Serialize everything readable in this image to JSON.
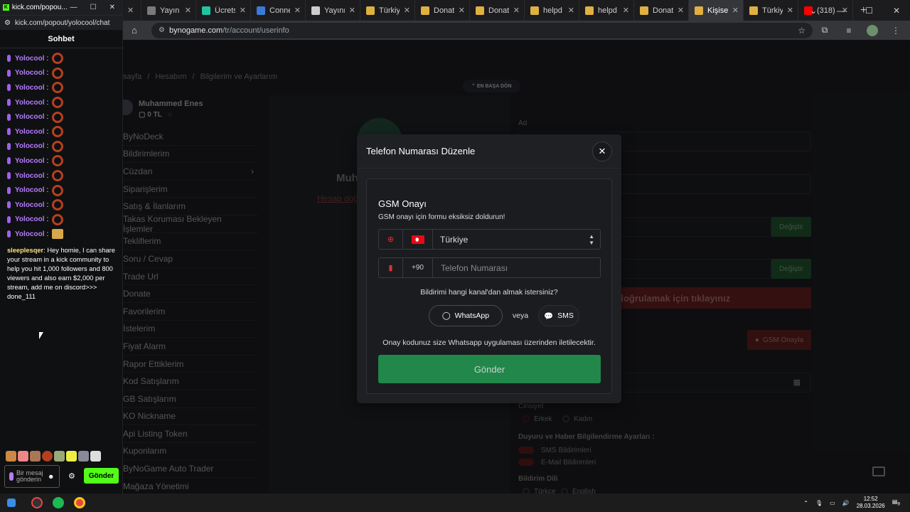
{
  "browser": {
    "tabs": [
      {
        "title": "Yayın y",
        "color": "#7a7a7a"
      },
      {
        "title": "Ücrets",
        "color": "#20c5a0"
      },
      {
        "title": "Conne",
        "color": "#3b7bd6"
      },
      {
        "title": "Yayını",
        "color": "#cccccc"
      },
      {
        "title": "Türkiye",
        "color": "#e0b040"
      },
      {
        "title": "Donat",
        "color": "#e0b040"
      },
      {
        "title": "Donat",
        "color": "#e0b040"
      },
      {
        "title": "helpd",
        "color": "#e0b040"
      },
      {
        "title": "helpd",
        "color": "#e0b040"
      },
      {
        "title": "Donat",
        "color": "#e0b040"
      },
      {
        "title": "Kişisel",
        "color": "#e0b040",
        "active": true
      },
      {
        "title": "Türkiye",
        "color": "#e0b040"
      },
      {
        "title": "(318)",
        "color": "#ff0000"
      }
    ],
    "url_domain": "bynogame.com",
    "url_path": "/tr/account/userinfo"
  },
  "site": {
    "breadcrumbs": [
      "sayfa",
      "/",
      "Hesabım",
      "/",
      "Bilgilerim ve Ayarlarım"
    ],
    "back_to_top": "EN BAŞA DÖN",
    "user_name": "Muhammed Enes",
    "balance": "0 TL",
    "menu": [
      "ByNoDeck",
      "Bildirimlerim",
      "Cüzdan",
      "Siparişlerim",
      "Satış & İlanlarım",
      "Takas Koruması Bekleyen İşlemler",
      "Tekliflerim",
      "Soru / Cevap",
      "Trade Url",
      "Donate",
      "Favorilerim",
      "İstelerim",
      "Fiyat Alarm",
      "Rapor Ettiklerim",
      "Kod Satışlarım",
      "GB Satışlarım",
      "KO Nickname",
      "Api Listing Token",
      "Kuponlarım",
      "ByNoGame Auto Trader",
      "Mağaza Yönetimi"
    ],
    "profile_name": "Muh",
    "account_link": "Hesap doğ",
    "label_ad": "Ad",
    "degistir": "Değiştir",
    "verify_text": "doğrulamak için tıklayınız",
    "gsm_onayla": "GSM Onayla",
    "gender_label": "Cinsiyet",
    "gender_male": "Erkek",
    "gender_female": "Kadın",
    "notif_label": "Duyuru ve Haber Bilgilendirme Ayarları :",
    "sms_notif": "SMS Bildirimleri",
    "email_notif": "E-Mail Bildirimleri",
    "lang_label": "Bildirim Dili",
    "lang_tr": "Türkçe",
    "lang_en": "English"
  },
  "modal": {
    "title": "Telefon Numarası Düzenle",
    "gsm_title": "GSM Onayı",
    "gsm_subtitle": "GSM onayı için formu eksiksiz doldurun!",
    "country": "Türkiye",
    "country_code": "+90",
    "phone_placeholder": "Telefon Numarası",
    "channel_question": "Bildirimi hangi kanal'dan almak istersiniz?",
    "whatsapp": "WhatsApp",
    "or": "veya",
    "sms": "SMS",
    "info": "Onay kodunuz size Whatsapp uygulaması üzerinden iletilecektir.",
    "send": "Gönder"
  },
  "chat": {
    "window_title": "kick.com/popou...",
    "url": "kick.com/popout/yolocool/chat",
    "header": "Sohbet",
    "repeat_user": "Yolocool",
    "long_user": "sleeplesqer",
    "long_text": "Hey homie, I can share your stream in a kick community to help you hit 1,000 followers and 800 viewers and also earn $2,000 per stream, add me on discord>>> done_111",
    "input_placeholder": "Bir mesaj gönderin",
    "send": "Gönder"
  },
  "taskbar": {
    "time": "12:52",
    "date": "28.03.2026",
    "notif_count": "9"
  }
}
